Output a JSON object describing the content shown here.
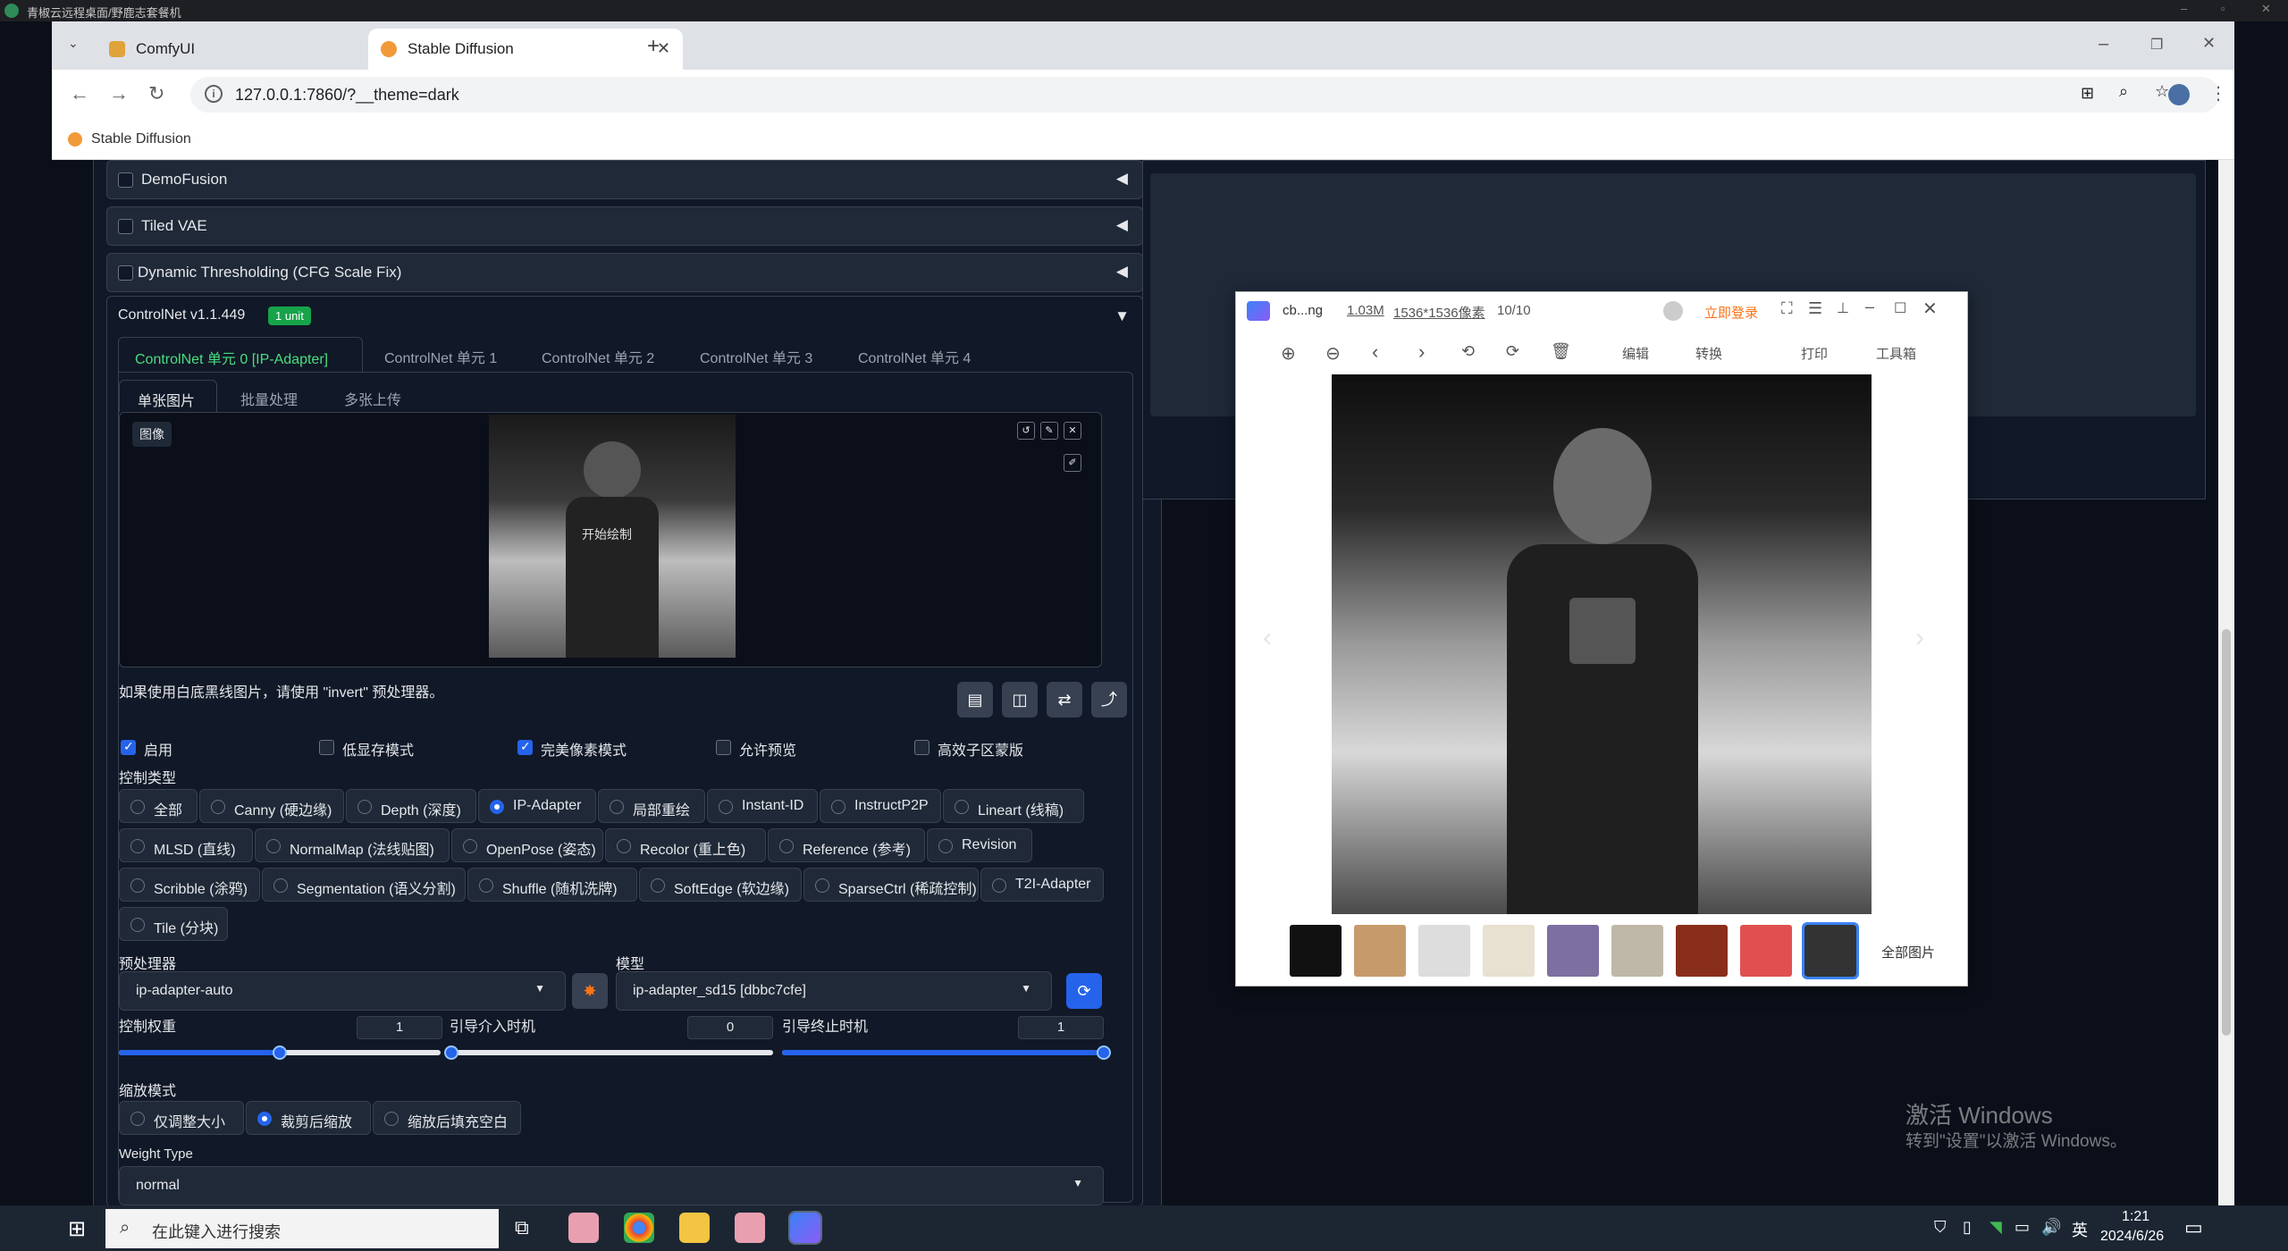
{
  "remote_bar": {
    "title": "青椒云远程桌面/野鹿志套餐机"
  },
  "browser": {
    "tabs": [
      {
        "label": "ComfyUI",
        "active": false
      },
      {
        "label": "Stable Diffusion",
        "active": true
      }
    ],
    "new_tab": "+",
    "url": "127.0.0.1:7860/?__theme=dark",
    "bookmark": "Stable Diffusion",
    "window_controls": [
      "–",
      "❐",
      "✕"
    ]
  },
  "accordions": [
    {
      "label": "DemoFusion"
    },
    {
      "label": "Tiled VAE"
    },
    {
      "label": "Dynamic Thresholding (CFG Scale Fix)"
    }
  ],
  "controlnet": {
    "title": "ControlNet v1.1.449",
    "badge": "1 unit",
    "units": [
      "ControlNet 单元 0 [IP-Adapter]",
      "ControlNet 单元 1",
      "ControlNet 单元 2",
      "ControlNet 单元 3",
      "ControlNet 单元 4"
    ],
    "input_tabs": [
      "单张图片",
      "批量处理",
      "多张上传"
    ],
    "image_label": "图像",
    "image_overlay": "开始绘制",
    "hint": "如果使用白底黑线图片，请使用 \"invert\" 预处理器。",
    "options": [
      {
        "label": "启用",
        "checked": true
      },
      {
        "label": "低显存模式",
        "checked": false
      },
      {
        "label": "完美像素模式",
        "checked": true
      },
      {
        "label": "允许预览",
        "checked": false
      },
      {
        "label": "高效子区蒙版",
        "checked": false
      }
    ],
    "control_type_label": "控制类型",
    "control_types_row1": [
      "全部",
      "Canny (硬边缘)",
      "Depth (深度)",
      "IP-Adapter",
      "局部重绘",
      "Instant-ID",
      "InstructP2P",
      "Lineart (线稿)"
    ],
    "control_types_row2": [
      "MLSD (直线)",
      "NormalMap (法线贴图)",
      "OpenPose (姿态)",
      "Recolor (重上色)",
      "Reference (参考)",
      "Revision"
    ],
    "control_types_row3": [
      "Scribble (涂鸦)",
      "Segmentation (语义分割)",
      "Shuffle (随机洗牌)",
      "SoftEdge (软边缘)",
      "SparseCtrl (稀疏控制)",
      "T2I-Adapter"
    ],
    "control_types_row4": [
      "Tile (分块)"
    ],
    "selected_type": "IP-Adapter",
    "preprocessor_label": "预处理器",
    "preprocessor": "ip-adapter-auto",
    "model_label": "模型",
    "model": "ip-adapter_sd15 [dbbc7cfe]",
    "weight_label": "控制权重",
    "weight": "1",
    "weight_fraction": 0.5,
    "start_label": "引导介入时机",
    "start": "0",
    "start_fraction": 0.0,
    "end_label": "引导终止时机",
    "end": "1",
    "end_fraction": 1.0,
    "resize_label": "缩放模式",
    "resize_modes": [
      "仅调整大小",
      "裁剪后缩放",
      "缩放后填充空白"
    ],
    "selected_resize": "裁剪后缩放",
    "weight_type_label": "Weight Type",
    "weight_type": "normal"
  },
  "viewer": {
    "filename": "cb...ng",
    "size": "1.03M",
    "dims": "1536*1536像素",
    "index": "10/10",
    "login": "立即登录",
    "tools": [
      "编辑",
      "转换",
      "打印",
      "工具箱"
    ],
    "all_images": "全部图片"
  },
  "watermark": {
    "line1": "激活 Windows",
    "line2": "转到\"设置\"以激活 Windows。"
  },
  "taskbar": {
    "search_placeholder": "在此键入进行搜索",
    "ime": "英",
    "time": "1:21",
    "date": "2024/6/26"
  }
}
